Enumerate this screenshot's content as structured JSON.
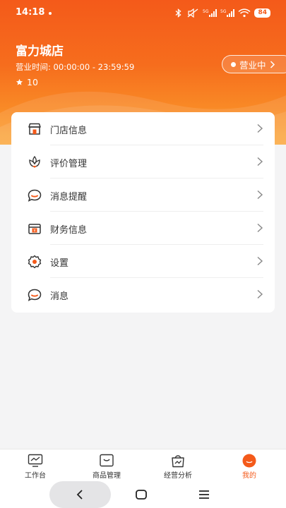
{
  "status_bar": {
    "time": "14:18",
    "battery": "84"
  },
  "store": {
    "name": "富力城店",
    "hours": "营业时间: 00:00:00 - 23:59:59",
    "rating": "10",
    "status": "营业中"
  },
  "menu": {
    "items": [
      {
        "label": "门店信息",
        "icon": "store-icon"
      },
      {
        "label": "评价管理",
        "icon": "review-icon"
      },
      {
        "label": "消息提醒",
        "icon": "chat-icon"
      },
      {
        "label": "财务信息",
        "icon": "finance-icon"
      },
      {
        "label": "设置",
        "icon": "gear-icon"
      },
      {
        "label": "消息",
        "icon": "chat-icon"
      }
    ]
  },
  "tabbar": {
    "tabs": [
      {
        "label": "工作台",
        "icon": "monitor-icon"
      },
      {
        "label": "商品管理",
        "icon": "product-icon"
      },
      {
        "label": "经营分析",
        "icon": "bag-icon"
      },
      {
        "label": "我的",
        "icon": "profile-icon"
      }
    ],
    "active_color": "#f45a1a"
  },
  "colors": {
    "brand": "#f45a1a",
    "header_bottom": "#fba331"
  }
}
